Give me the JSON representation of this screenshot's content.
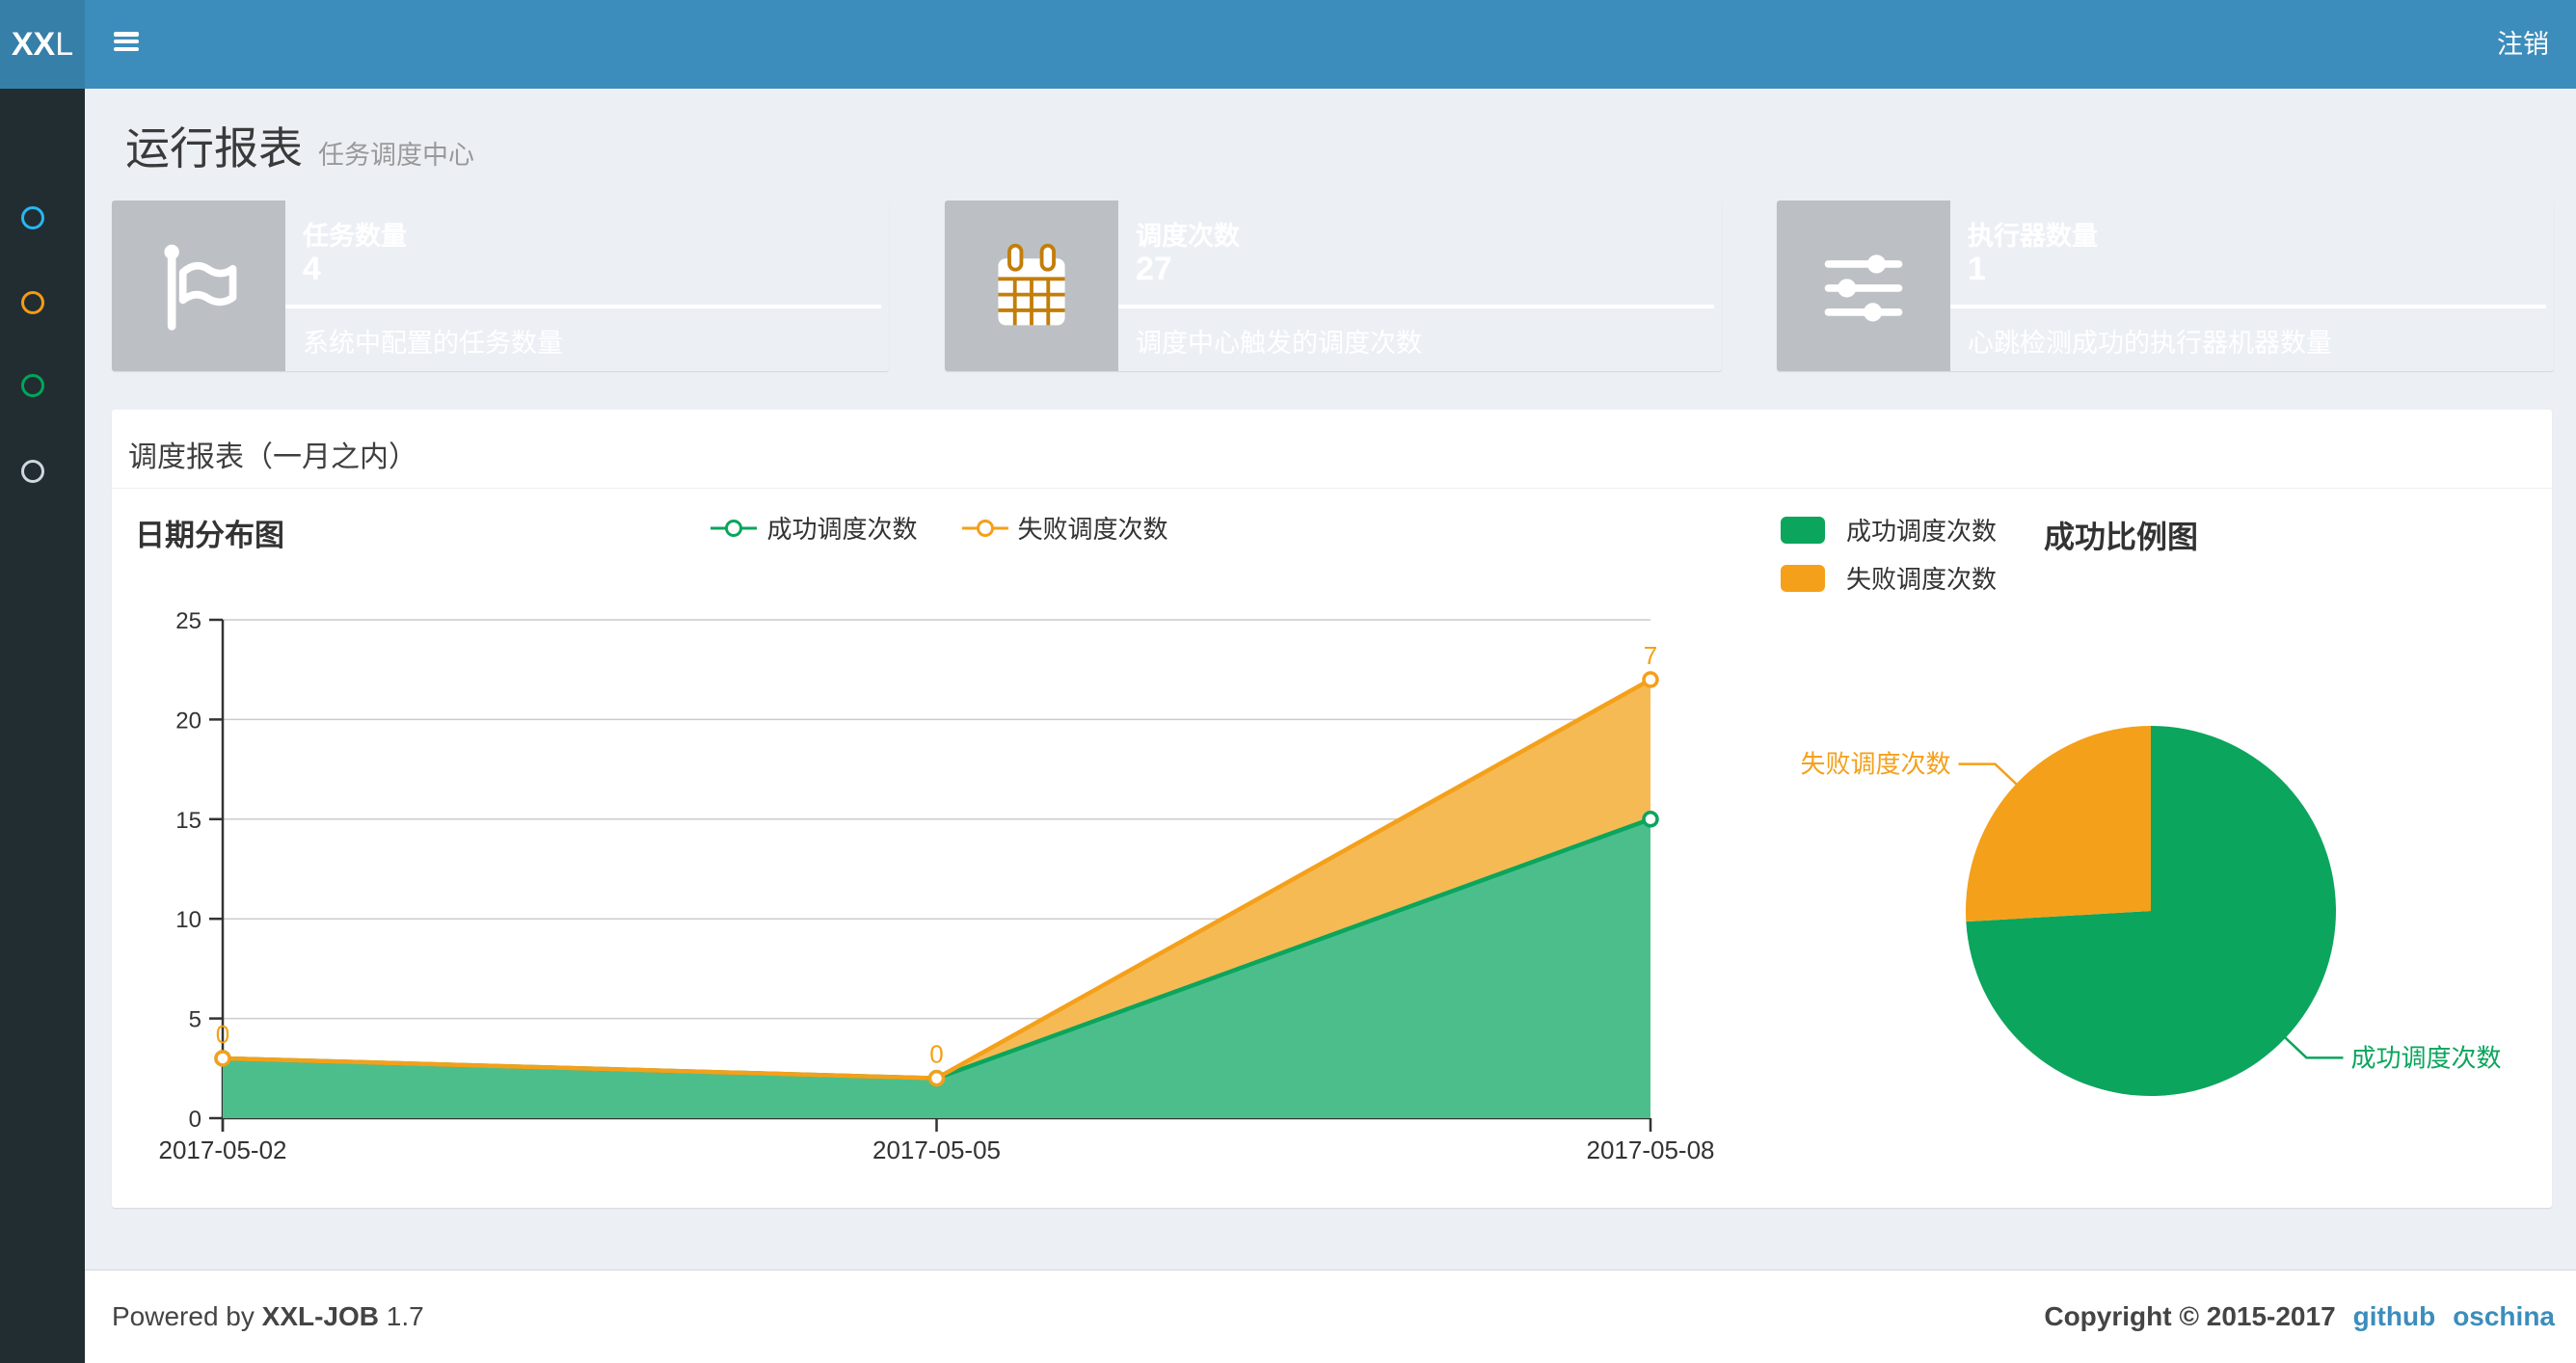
{
  "navbar": {
    "logo_bold": "XX",
    "logo_light": "L",
    "logout": "注销"
  },
  "sidebar": {
    "items": [
      {
        "name": "menu-1",
        "icon": "circle-outline-icon",
        "color": "#28B7F0"
      },
      {
        "name": "menu-2",
        "icon": "circle-outline-icon",
        "color": "#F39C12"
      },
      {
        "name": "menu-3",
        "icon": "circle-outline-icon",
        "color": "#00A65A"
      },
      {
        "name": "menu-4",
        "icon": "circle-outline-icon",
        "color": "#D2D6DE"
      }
    ]
  },
  "page_header": {
    "title": "运行报表",
    "subtitle": "任务调度中心"
  },
  "info_boxes": [
    {
      "title": "任务数量",
      "value": "4",
      "desc": "系统中配置的任务数量",
      "color": "#00C0EF",
      "icon": "flag-icon"
    },
    {
      "title": "调度次数",
      "value": "27",
      "desc": "调度中心触发的调度次数",
      "color": "#F39C12",
      "icon": "calendar-icon"
    },
    {
      "title": "执行器数量",
      "value": "1",
      "desc": "心跳检测成功的执行器机器数量",
      "color": "#00A65A",
      "icon": "sliders-icon"
    }
  ],
  "panel": {
    "title": "调度报表（一月之内）"
  },
  "chart_data": [
    {
      "type": "area",
      "title": "日期分布图",
      "x": [
        "2017-05-02",
        "2017-05-05",
        "2017-05-08"
      ],
      "series": [
        {
          "name": "成功调度次数",
          "values": [
            3,
            2,
            15
          ],
          "color": "#0BA55D",
          "fill": "#4CBE8C"
        },
        {
          "name": "失败调度次数",
          "values": [
            0,
            0,
            7
          ],
          "color": "#F4A01A",
          "fill": "#F6BA55"
        }
      ],
      "stacked": true,
      "ylim": [
        0,
        25
      ],
      "yticks": [
        0,
        5,
        10,
        15,
        20,
        25
      ],
      "point_labels": {
        "series": "失败调度次数",
        "values": [
          "0",
          "0",
          "7"
        ]
      },
      "legend": [
        "成功调度次数",
        "失败调度次数"
      ],
      "legend_position": "top-center",
      "grid": "horizontal-only"
    },
    {
      "type": "pie",
      "title": "成功比例图",
      "slices": [
        {
          "label": "成功调度次数",
          "value": 20,
          "color": "#0BA55D"
        },
        {
          "label": "失败调度次数",
          "value": 7,
          "color": "#F4A01A"
        }
      ],
      "legend_position": "top-left",
      "start_angle_deg": 90,
      "clockwise": true
    }
  ],
  "footer": {
    "powered_prefix": "Powered by",
    "product": "XXL-JOB",
    "version": "1.7",
    "copyright": "Copyright © 2015-2017",
    "links": [
      "github",
      "oschina"
    ]
  },
  "colors": {
    "navbar": "#3C8DBC",
    "logo_bg": "#367FA9",
    "sidebar_bg": "#222D32",
    "content_bg": "#ECF0F5",
    "link": "#3C8DBC",
    "box_aqua": "#00C0EF",
    "box_orange": "#F39C12",
    "box_green": "#00A65A",
    "chart_green": "#0BA55D",
    "chart_orange": "#F4A01A",
    "axis_text": "#333333",
    "grid_line": "#CCCCCC"
  }
}
